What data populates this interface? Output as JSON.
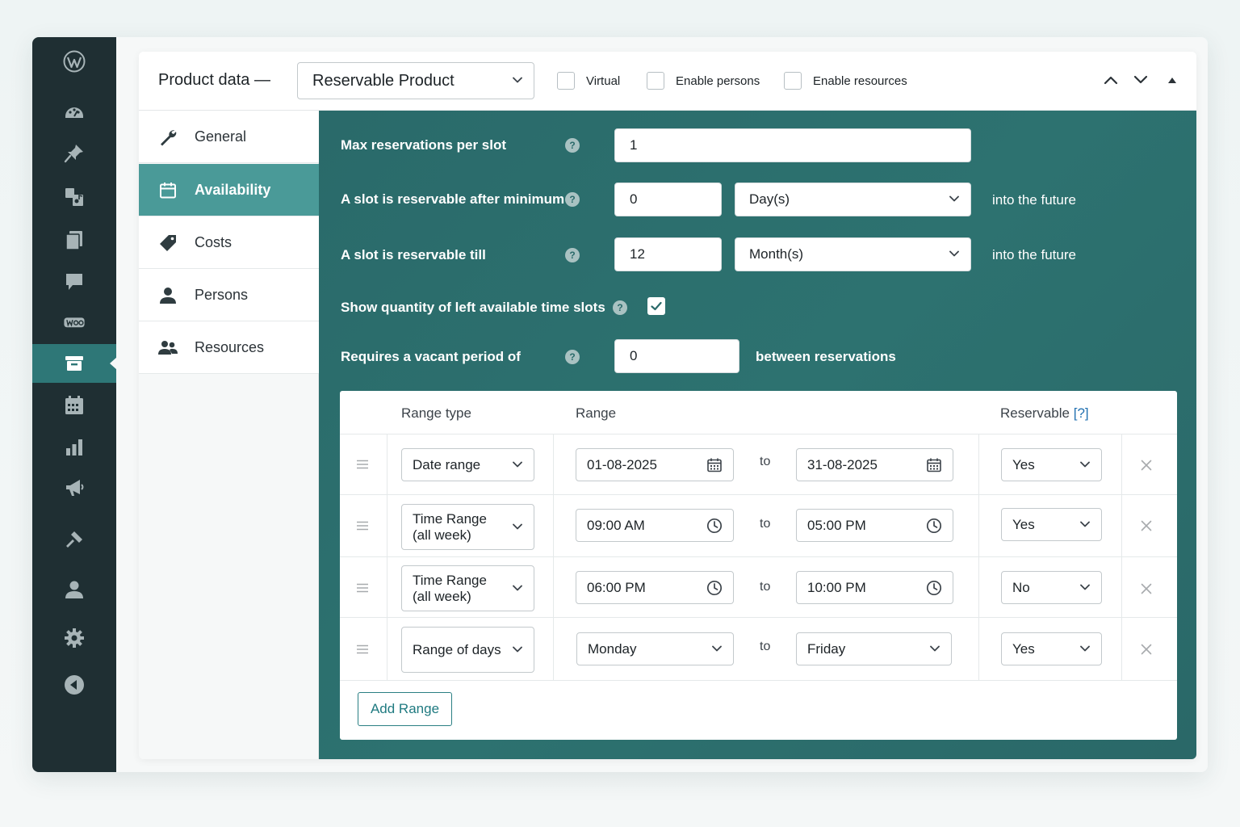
{
  "header": {
    "title": "Product data —",
    "product_type": "Reservable Product",
    "checks": [
      {
        "label": "Virtual",
        "checked": false
      },
      {
        "label": "Enable persons",
        "checked": false
      },
      {
        "label": "Enable resources",
        "checked": false
      }
    ],
    "icons": [
      "chevron-up-icon",
      "chevron-down-icon",
      "triangle-up-icon"
    ]
  },
  "admin_menu": [
    "wordpress-logo-icon",
    "dashboard-icon",
    "pin-icon",
    "media-icon",
    "pages-icon",
    "comments-icon",
    "woocommerce-icon",
    "products-icon",
    "calendar-icon",
    "analytics-icon",
    "marketing-icon",
    "tools-icon",
    "users-icon",
    "settings-icon",
    "collapse-icon"
  ],
  "tabs": [
    {
      "label": "General",
      "icon": "wrench-icon"
    },
    {
      "label": "Availability",
      "icon": "calendar-icon",
      "active": true
    },
    {
      "label": "Costs",
      "icon": "tag-icon"
    },
    {
      "label": "Persons",
      "icon": "person-icon"
    },
    {
      "label": "Resources",
      "icon": "group-icon"
    }
  ],
  "availability": {
    "max_per_slot": {
      "label": "Max reservations per slot",
      "value": "1"
    },
    "min_advance": {
      "label": "A slot is reservable after minimum",
      "value": "0",
      "unit": "Day(s)",
      "suffix": "into the future"
    },
    "max_advance": {
      "label": "A slot is reservable till",
      "value": "12",
      "unit": "Month(s)",
      "suffix": "into the future"
    },
    "show_quantity": {
      "label": "Show quantity of left available time slots",
      "checked": true
    },
    "buffer": {
      "label": "Requires a vacant period of",
      "value": "0",
      "suffix": "between reservations"
    },
    "help_glyph": "?"
  },
  "ranges": {
    "headers": {
      "type": "Range type",
      "range": "Range",
      "reservable": "Reservable",
      "reservable_help": "[?]"
    },
    "to_label": "to",
    "add_label": "Add Range",
    "rows": [
      {
        "type": "Date range",
        "from": "01-08-2025",
        "to": "31-08-2025",
        "reservable": "Yes",
        "kind": "date"
      },
      {
        "type": "Time Range (all week)",
        "from": "09:00 AM",
        "to": "05:00 PM",
        "reservable": "Yes",
        "kind": "time"
      },
      {
        "type": "Time Range (all week)",
        "from": "06:00 PM",
        "to": "10:00 PM",
        "reservable": "No",
        "kind": "time"
      },
      {
        "type": "Range of days",
        "from": "Monday",
        "to": "Friday",
        "reservable": "Yes",
        "kind": "day"
      }
    ]
  },
  "colors": {
    "accent": "#2d7270",
    "active_tab": "#4a9a98",
    "admin_bg": "#1f2f33",
    "link": "#2271b1"
  }
}
